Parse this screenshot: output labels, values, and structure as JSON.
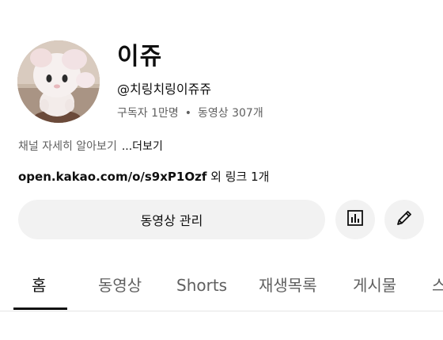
{
  "channel": {
    "name": "이쥬",
    "handle": "@치링치링이쥬쥬",
    "subscribers": "구독자 1만명",
    "separator": "•",
    "videos": "동영상 307개",
    "about": "채널 자세히 알아보기",
    "more": "...더보기",
    "link": "open.kakao.com/o/s9xP1Ozf",
    "link_extra": " 외 링크 1개"
  },
  "actions": {
    "manage_videos": "동영상 관리",
    "analytics_icon": "bar-chart-icon",
    "edit_icon": "pencil-icon"
  },
  "tabs": [
    {
      "label": "홈",
      "active": true
    },
    {
      "label": "동영상",
      "active": false
    },
    {
      "label": "Shorts",
      "active": false
    },
    {
      "label": "재생목록",
      "active": false
    },
    {
      "label": "게시물",
      "active": false
    },
    {
      "label": "스",
      "active": false
    }
  ],
  "colors": {
    "text": "#0f0f0f",
    "secondary_text": "#606060",
    "button_bg": "#f2f2f2",
    "divider": "#e5e5e5"
  }
}
